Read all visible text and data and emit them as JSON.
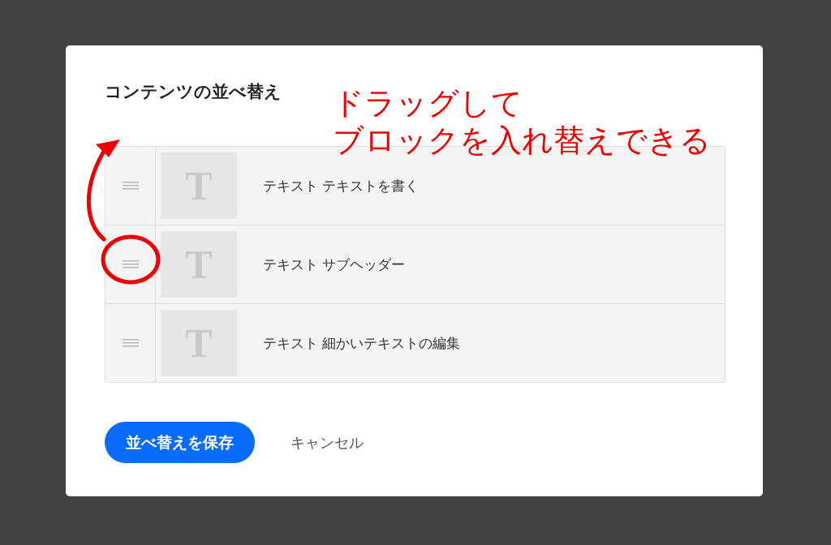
{
  "dialog": {
    "title": "コンテンツの並べ替え",
    "blocks": [
      {
        "icon": "T",
        "label": "テキスト テキストを書く",
        "circled": false
      },
      {
        "icon": "T",
        "label": "テキスト サブヘッダー",
        "circled": true
      },
      {
        "icon": "T",
        "label": "テキスト 細かいテキストの編集",
        "circled": false
      }
    ],
    "buttons": [
      {
        "kind": "primary",
        "label": "並べ替えを保存"
      },
      {
        "kind": "text",
        "label": "キャンセル"
      }
    ]
  },
  "annotation": {
    "lines": [
      "ドラッグして",
      "ブロックを入れ替えできる"
    ]
  }
}
